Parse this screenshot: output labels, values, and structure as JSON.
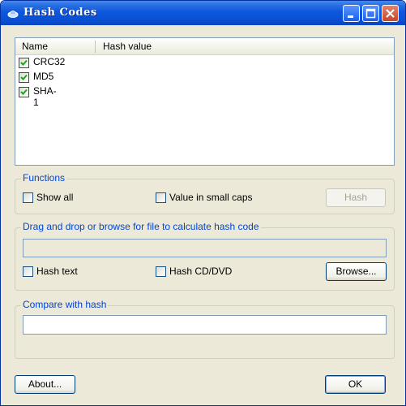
{
  "window": {
    "title": "Hash Codes"
  },
  "listview": {
    "columns": [
      "Name",
      "Hash value"
    ],
    "rows": [
      {
        "name": "CRC32",
        "hash": "",
        "checked": true
      },
      {
        "name": "MD5",
        "hash": "",
        "checked": true
      },
      {
        "name": "SHA-1",
        "hash": "",
        "checked": true
      }
    ]
  },
  "functions": {
    "title": "Functions",
    "show_all": "Show all",
    "small_caps": "Value in small caps",
    "hash_button": "Hash"
  },
  "file_group": {
    "title": "Drag and drop or browse for file to calculate hash code",
    "path_value": "",
    "hash_text": "Hash text",
    "hash_cd": "Hash CD/DVD",
    "browse_button": "Browse..."
  },
  "compare_group": {
    "title": "Compare with hash",
    "value": ""
  },
  "footer": {
    "about_button": "About...",
    "ok_button": "OK"
  },
  "colors": {
    "titlebar": "#0a4fd2",
    "group_title": "#0046d5",
    "dialog_bg": "#ece9d8"
  },
  "icons": {
    "app": "hash-app-icon",
    "minimize": "minimize-icon",
    "maximize": "maximize-icon",
    "close": "close-icon",
    "check": "checkmark-icon"
  }
}
